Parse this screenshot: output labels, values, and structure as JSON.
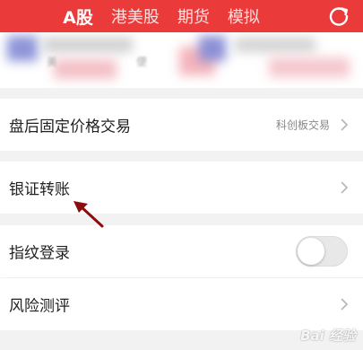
{
  "header": {
    "tabs": [
      {
        "label": "A股",
        "active": true
      },
      {
        "label": "港美股",
        "active": false
      },
      {
        "label": "期货",
        "active": false
      },
      {
        "label": "模拟",
        "active": false
      }
    ],
    "refresh_icon": "refresh-icon",
    "background_color": "#ea3a3a"
  },
  "promo": {
    "left_caption": "美",
    "right_caption": "便"
  },
  "rows": [
    {
      "label": "盘后固定价格交易",
      "sub": "科创板交易",
      "has_chevron": true
    },
    {
      "label": "银证转账",
      "sub": "",
      "has_chevron": true
    },
    {
      "label": "指纹登录",
      "toggle_on": false
    },
    {
      "label": "风险测评",
      "sub": "",
      "has_chevron": true
    }
  ],
  "annotation": {
    "arrow_color": "#8b0d0d"
  },
  "watermark": {
    "text": "Bai 经验"
  }
}
